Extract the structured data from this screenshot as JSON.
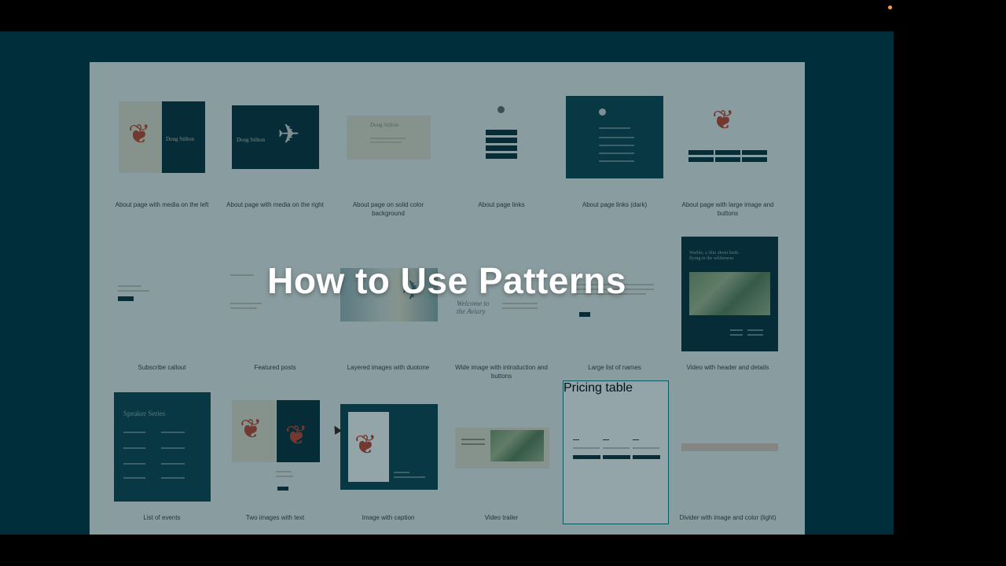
{
  "overlay_title": "How to Use Patterns",
  "accent_selected": "#0e7f84",
  "patterns": [
    {
      "label": "About page with media on the left"
    },
    {
      "label": "About page with media on the right"
    },
    {
      "label": "About page on solid color background"
    },
    {
      "label": "About page links"
    },
    {
      "label": "About page links (dark)"
    },
    {
      "label": "About page with large image and buttons"
    },
    {
      "label": "Subscribe callout"
    },
    {
      "label": "Featured posts"
    },
    {
      "label": "Layered images with duotone"
    },
    {
      "label": "Wide image with introduction and buttons"
    },
    {
      "label": "Large list of names"
    },
    {
      "label": "Video with header and details"
    },
    {
      "label": "List of events"
    },
    {
      "label": "Two images with text"
    },
    {
      "label": "Image with caption"
    },
    {
      "label": "Video trailer"
    },
    {
      "label": "Pricing table"
    },
    {
      "label": "Divider with image and color (light)"
    }
  ],
  "thumb_text": {
    "about_left_heading": "Doug Stilton",
    "about_right_heading": "Doug Stilton",
    "solid_heading": "Doug Stilton",
    "wide_intro": "Welcome to the Aviary",
    "video_header": "Warble, a film about birds flying in the wilderness",
    "events_heading": "Speaker Series"
  }
}
